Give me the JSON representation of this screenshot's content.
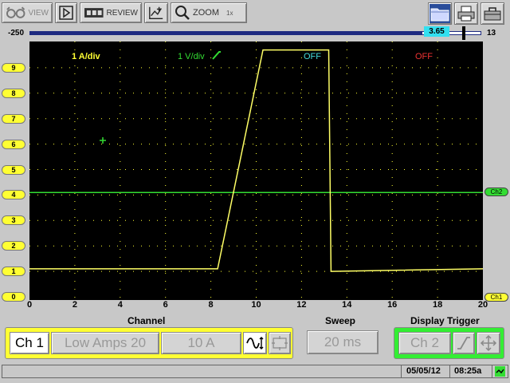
{
  "toolbar": {
    "view_label": "VIEW",
    "review_label": "REVIEW",
    "zoom_label": "ZOOM",
    "zoom_level": "1x"
  },
  "slider": {
    "left": "-250",
    "value": "3.65",
    "right": "13",
    "position_fraction": 0.87
  },
  "scope": {
    "ch1_scale": "1 A/div",
    "ch2_scale": "1 V/div",
    "ch3_status": "OFF",
    "ch4_status": "OFF",
    "left_axis_ticks": [
      "9",
      "8",
      "7",
      "6",
      "5",
      "4",
      "3",
      "2",
      "1",
      "0"
    ],
    "x_axis_ticks": [
      "0",
      "2",
      "4",
      "6",
      "8",
      "10",
      "12",
      "14",
      "16",
      "18",
      "20"
    ],
    "ch2_tag": "Ch2",
    "ch1_tag": "Ch1",
    "colors": {
      "ch1": "#ffff66",
      "ch2": "#33dd33",
      "ch3": "#44dddd",
      "ch4": "#ee3333",
      "grid": "#ffff33"
    }
  },
  "chart_data": {
    "type": "line",
    "xlabel": "",
    "ylabel": "",
    "xlim": [
      0,
      20
    ],
    "ylim": [
      0,
      9
    ],
    "series": [
      {
        "name": "Ch1",
        "x": [
          0,
          8.3,
          10.3,
          13.2,
          13.3,
          20
        ],
        "y": [
          1.1,
          1.1,
          9.7,
          9.7,
          1.0,
          1.1
        ]
      },
      {
        "name": "Ch2",
        "x": [
          0,
          20
        ],
        "y": [
          4.1,
          4.1
        ]
      }
    ]
  },
  "controls": {
    "channel_label": "Channel",
    "sweep_label": "Sweep",
    "trigger_label": "Display Trigger",
    "ch1": "Ch 1",
    "probe": "Low Amps 20",
    "range": "10 A",
    "sweep": "20 ms",
    "trigger_channel": "Ch 2"
  },
  "status": {
    "date": "05/05/12",
    "time": "08:25a"
  }
}
